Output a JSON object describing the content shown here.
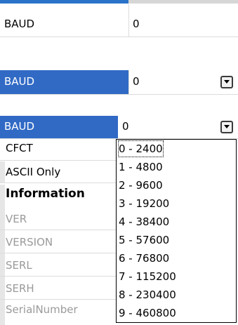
{
  "section1": {
    "name": "BAUD",
    "value": "0"
  },
  "section2": {
    "name": "BAUD",
    "value": "0"
  },
  "section3": {
    "selected": {
      "name": "BAUD",
      "value": "0"
    },
    "rows": [
      {
        "name": "CFCT",
        "style": "normal"
      },
      {
        "name": "ASCII Only",
        "style": "normal"
      },
      {
        "name": "Information",
        "style": "section"
      },
      {
        "name": "VER",
        "style": "disabled"
      },
      {
        "name": "VERSION",
        "style": "disabled"
      },
      {
        "name": "SERL",
        "style": "disabled"
      },
      {
        "name": "SERH",
        "style": "disabled"
      },
      {
        "name": "SerialNumber",
        "style": "disabled"
      }
    ],
    "dropdown_options": [
      "0 - 2400",
      "1 - 4800",
      "2 - 9600",
      "3 - 19200",
      "4 - 38400",
      "5 - 57600",
      "6 - 76800",
      "7 - 115200",
      "8 - 230400",
      "9 - 460800"
    ],
    "dropdown_focused_index": 0
  },
  "icons": {
    "dropdown_button": "chevron-down-icon"
  },
  "colors": {
    "selection": "#316ac5",
    "accent_line": "#2a73c9",
    "disabled_text": "#9a9a9a"
  }
}
